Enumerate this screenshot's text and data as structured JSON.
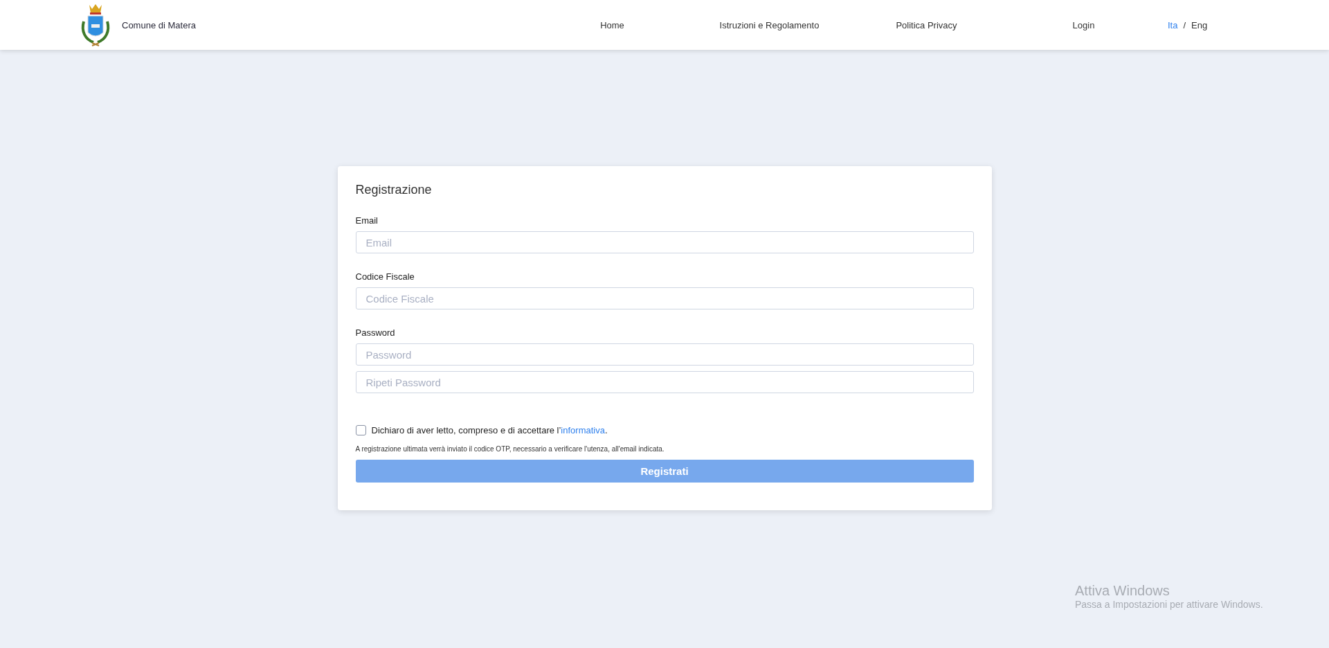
{
  "header": {
    "site_name": "Comune di Matera",
    "nav": [
      {
        "label": "Home"
      },
      {
        "label": "Istruzioni e Regolamento"
      },
      {
        "label": "Politica Privacy"
      },
      {
        "label": "Login"
      }
    ],
    "languages": [
      {
        "label": "Ita",
        "selected": true
      },
      {
        "label": "Eng",
        "selected": false
      }
    ],
    "language_separator": "/"
  },
  "form": {
    "title": "Registrazione",
    "groups": [
      {
        "label": "Email",
        "fields": [
          {
            "placeholder": "Email"
          }
        ]
      },
      {
        "label": "Codice Fiscale",
        "fields": [
          {
            "placeholder": "Codice Fiscale"
          }
        ]
      },
      {
        "label": "Password",
        "fields": [
          {
            "placeholder": "Password"
          },
          {
            "placeholder": "Ripeti Password"
          }
        ]
      }
    ],
    "consent": {
      "checked": false,
      "text": "Dichiaro di aver letto, compreso e di accettare l’",
      "link": "informativa",
      "suffix": "."
    },
    "note": "A registrazione ultimata verrà inviato il codice OTP, necessario a verificare l'utenza, all'email indicata.",
    "submit": {
      "label": "Registrati",
      "disabled": true
    }
  },
  "os_watermark": {
    "title": "Attiva Windows",
    "subtitle": "Passa a Impostazioni per attivare Windows."
  }
}
